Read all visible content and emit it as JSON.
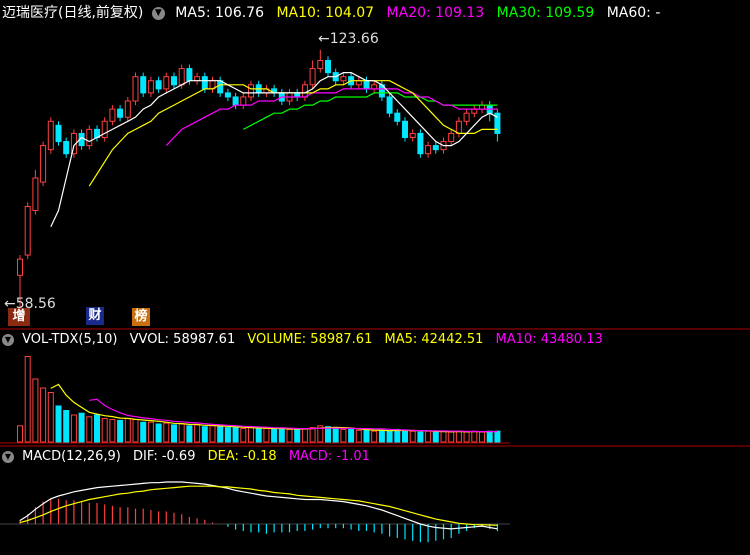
{
  "colors": {
    "up": "#ff4040",
    "down": "#00e6ff",
    "ma5": "#ffffff",
    "ma10": "#ffff00",
    "ma20": "#ff00ff",
    "ma30": "#00ff00",
    "grid": "#b00000"
  },
  "header": {
    "title": "迈瑞医疗(日线,前复权)",
    "ma5": "MA5: 106.76",
    "ma10": "MA10: 104.07",
    "ma20": "MA20: 109.13",
    "ma30": "MA30: 109.59",
    "ma60": "MA60: -"
  },
  "labels": {
    "high": "123.66",
    "low": "58.56",
    "badge1": "增",
    "badge2": "财",
    "badge3": "榜"
  },
  "vol_header": {
    "name": "VOL-TDX(5,10)",
    "vvol": "VVOL: 58987.61",
    "volume": "VOLUME: 58987.61",
    "ma5": "MA5: 42442.51",
    "ma10": "MA10: 43480.13"
  },
  "macd_header": {
    "name": "MACD(12,26,9)",
    "dif": "DIF: -0.69",
    "dea": "DEA: -0.18",
    "macd": "MACD: -1.01"
  },
  "chart_data": {
    "type": "candlestick",
    "price_ylim": [
      55,
      130
    ],
    "high_label": 123.66,
    "low_label": 58.56,
    "candles": [
      [
        68,
        72,
        58.56,
        73
      ],
      [
        73,
        85,
        72,
        86
      ],
      [
        84,
        92,
        83,
        94
      ],
      [
        91,
        100,
        90,
        101
      ],
      [
        99,
        106,
        98,
        107
      ],
      [
        105,
        101,
        100,
        106
      ],
      [
        101,
        98,
        97,
        102
      ],
      [
        98,
        103,
        97,
        104
      ],
      [
        103,
        100,
        99,
        104
      ],
      [
        100,
        104,
        99,
        105
      ],
      [
        104,
        102,
        101,
        105
      ],
      [
        102,
        106,
        101,
        107
      ],
      [
        106,
        109,
        105,
        110
      ],
      [
        109,
        107,
        106,
        110
      ],
      [
        107,
        111,
        106,
        112
      ],
      [
        111,
        117,
        110,
        118
      ],
      [
        117,
        113,
        112,
        118
      ],
      [
        113,
        116,
        112,
        117
      ],
      [
        116,
        114,
        113,
        117
      ],
      [
        114,
        117,
        113,
        118
      ],
      [
        117,
        115,
        114,
        118
      ],
      [
        115,
        119,
        114,
        120
      ],
      [
        119,
        116,
        115,
        120
      ],
      [
        116,
        117,
        115,
        118
      ],
      [
        117,
        114,
        113,
        118
      ],
      [
        114,
        116,
        113,
        117
      ],
      [
        116,
        113,
        112,
        117
      ],
      [
        113,
        112,
        111,
        114
      ],
      [
        112,
        110,
        109,
        113
      ],
      [
        110,
        112,
        109,
        113
      ],
      [
        112,
        115,
        111,
        116
      ],
      [
        115,
        113,
        112,
        116
      ],
      [
        113,
        114,
        112,
        115
      ],
      [
        114,
        113,
        112,
        115
      ],
      [
        113,
        111,
        110,
        114
      ],
      [
        111,
        113,
        110,
        114
      ],
      [
        113,
        112,
        111,
        114
      ],
      [
        112,
        115,
        111,
        116
      ],
      [
        115,
        119,
        114,
        121
      ],
      [
        119,
        121,
        118,
        123.66
      ],
      [
        121,
        118,
        117,
        122
      ],
      [
        118,
        116,
        115,
        119
      ],
      [
        116,
        117,
        115,
        118
      ],
      [
        117,
        115,
        114,
        118
      ],
      [
        115,
        116,
        114,
        117
      ],
      [
        116,
        114,
        113,
        117
      ],
      [
        114,
        115,
        113,
        116
      ],
      [
        115,
        112,
        111,
        116
      ],
      [
        112,
        108,
        107,
        113
      ],
      [
        108,
        106,
        105,
        109
      ],
      [
        106,
        102,
        101,
        107
      ],
      [
        102,
        103,
        101,
        104
      ],
      [
        103,
        98,
        97,
        104
      ],
      [
        98,
        100,
        97,
        101
      ],
      [
        100,
        99,
        98,
        101
      ],
      [
        99,
        101,
        98,
        102
      ],
      [
        101,
        103,
        100,
        104
      ],
      [
        103,
        106,
        102,
        107
      ],
      [
        106,
        108,
        105,
        109
      ],
      [
        108,
        109,
        107,
        110
      ],
      [
        109,
        110,
        108,
        111
      ],
      [
        110,
        108,
        106,
        111
      ],
      [
        108,
        103,
        101,
        109
      ]
    ],
    "ma5": [
      null,
      null,
      null,
      null,
      80,
      84,
      92,
      100,
      102,
      101,
      102,
      103,
      104,
      105,
      106,
      107,
      109,
      110,
      112,
      113,
      114,
      115,
      116,
      116,
      116,
      116,
      116,
      115,
      114,
      113,
      113,
      113,
      113,
      113,
      113,
      113,
      113,
      113,
      114,
      116,
      117,
      117,
      118,
      118,
      117,
      116,
      116,
      115,
      113,
      111,
      109,
      107,
      105,
      103,
      101,
      100,
      100,
      101,
      103,
      105,
      107,
      108,
      107
    ],
    "ma10": [
      null,
      null,
      null,
      null,
      null,
      null,
      null,
      null,
      null,
      90,
      93,
      96,
      99,
      101,
      103,
      104,
      105,
      106,
      108,
      109,
      110,
      111,
      112,
      113,
      114,
      114,
      115,
      115,
      115,
      115,
      114,
      114,
      114,
      113,
      113,
      113,
      113,
      113,
      113,
      114,
      114,
      115,
      115,
      116,
      116,
      116,
      116,
      116,
      116,
      115,
      114,
      113,
      111,
      109,
      107,
      105,
      104,
      103,
      103,
      103,
      104,
      104,
      104
    ],
    "ma20": [
      null,
      null,
      null,
      null,
      null,
      null,
      null,
      null,
      null,
      null,
      null,
      null,
      null,
      null,
      null,
      null,
      null,
      null,
      null,
      100,
      102,
      104,
      105,
      106,
      107,
      108,
      109,
      109,
      110,
      110,
      110,
      111,
      111,
      111,
      112,
      112,
      112,
      112,
      113,
      113,
      113,
      113,
      114,
      114,
      114,
      114,
      114,
      114,
      114,
      114,
      113,
      113,
      112,
      112,
      111,
      110,
      110,
      109,
      109,
      109,
      109,
      109,
      109
    ],
    "ma30": [
      null,
      null,
      null,
      null,
      null,
      null,
      null,
      null,
      null,
      null,
      null,
      null,
      null,
      null,
      null,
      null,
      null,
      null,
      null,
      null,
      null,
      null,
      null,
      null,
      null,
      null,
      null,
      null,
      null,
      104,
      105,
      106,
      107,
      108,
      108,
      109,
      109,
      110,
      110,
      111,
      111,
      112,
      112,
      112,
      112,
      112,
      113,
      113,
      113,
      113,
      112,
      112,
      112,
      111,
      111,
      110,
      110,
      110,
      110,
      110,
      110,
      110,
      110
    ],
    "volume": [
      18,
      95,
      70,
      60,
      55,
      40,
      35,
      30,
      32,
      28,
      30,
      26,
      25,
      24,
      26,
      25,
      22,
      22,
      20,
      21,
      19,
      20,
      18,
      19,
      17,
      18,
      17,
      16,
      16,
      15,
      16,
      15,
      15,
      14,
      15,
      14,
      14,
      15,
      16,
      18,
      17,
      15,
      14,
      14,
      13,
      13,
      12,
      13,
      12,
      14,
      13,
      12,
      11,
      12,
      11,
      12,
      11,
      12,
      11,
      12,
      11,
      12,
      12
    ],
    "vol_ylim": [
      0,
      100
    ],
    "dif": [
      0.5,
      1.2,
      2.1,
      2.9,
      3.6,
      4.0,
      4.3,
      4.6,
      4.8,
      5.0,
      5.2,
      5.3,
      5.4,
      5.5,
      5.6,
      5.7,
      5.8,
      5.9,
      5.9,
      6.0,
      6.0,
      6.0,
      5.9,
      5.8,
      5.7,
      5.5,
      5.3,
      5.1,
      4.8,
      4.6,
      4.4,
      4.2,
      4.0,
      3.9,
      3.8,
      3.7,
      3.6,
      3.5,
      3.5,
      3.5,
      3.4,
      3.3,
      3.2,
      3.0,
      2.8,
      2.6,
      2.3,
      2.0,
      1.6,
      1.2,
      0.8,
      0.4,
      0.0,
      -0.3,
      -0.5,
      -0.6,
      -0.7,
      -0.6,
      -0.5,
      -0.4,
      -0.3,
      -0.5,
      -0.69
    ],
    "dea": [
      0.2,
      0.5,
      0.9,
      1.3,
      1.8,
      2.2,
      2.6,
      2.9,
      3.2,
      3.5,
      3.7,
      3.9,
      4.1,
      4.3,
      4.4,
      4.6,
      4.7,
      4.9,
      5.0,
      5.1,
      5.2,
      5.3,
      5.4,
      5.4,
      5.4,
      5.4,
      5.3,
      5.3,
      5.2,
      5.1,
      5.0,
      4.8,
      4.7,
      4.5,
      4.4,
      4.3,
      4.1,
      4.0,
      3.9,
      3.8,
      3.7,
      3.6,
      3.5,
      3.4,
      3.3,
      3.1,
      2.9,
      2.7,
      2.5,
      2.2,
      1.9,
      1.6,
      1.3,
      1.0,
      0.7,
      0.5,
      0.3,
      0.1,
      0.0,
      -0.1,
      -0.1,
      -0.15,
      -0.18
    ],
    "macd_ylim": [
      -4,
      8
    ]
  }
}
